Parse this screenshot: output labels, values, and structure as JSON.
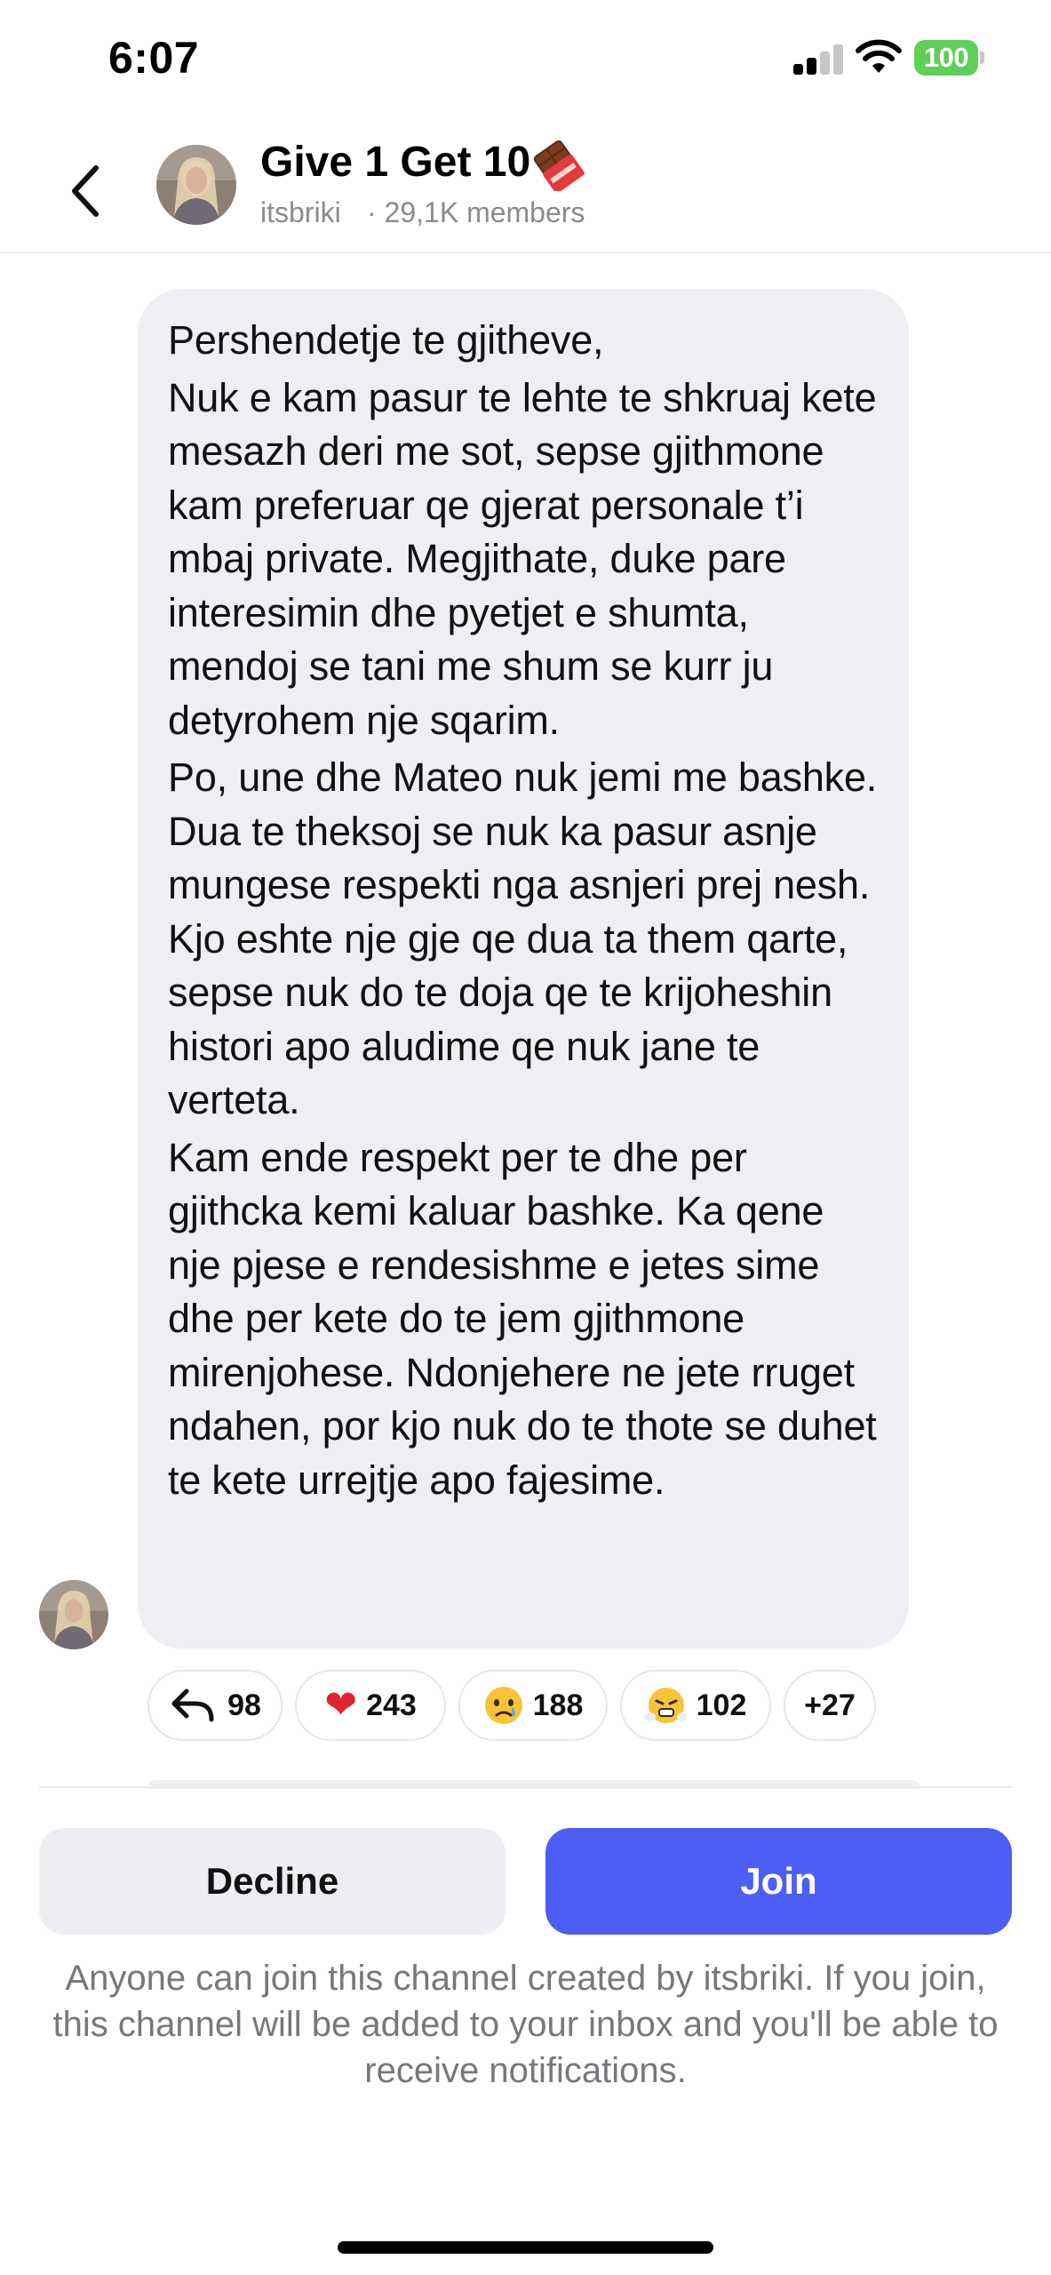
{
  "status_bar": {
    "time": "6:07",
    "battery": "100",
    "icons": [
      "signal-icon",
      "wifi-icon",
      "battery-icon"
    ],
    "battery_color": "#5fcf5a"
  },
  "header": {
    "back_icon": "chevron-left-icon",
    "title": "Give 1 Get 10",
    "title_emoji": "chocolate-bar-icon",
    "owner": "itsbriki",
    "members": "· 29,1K members"
  },
  "message": {
    "paragraphs": [
      "Pershendetje te gjitheve,",
      "Nuk e kam pasur te lehte te shkruaj kete mesazh deri me sot, sepse gjithmone kam preferuar qe gjerat personale t’i mbaj private. Megjithate, duke pare interesimin dhe pyetjet e shumta, mendoj se tani me shum se kurr ju detyrohem nje sqarim.",
      "Po, une dhe Mateo nuk jemi me bashke. Dua te theksoj se nuk ka pasur asnje mungese respekti nga asnjeri prej nesh. Kjo eshte nje gje qe dua ta them qarte, sepse nuk do te doja qe te krijoheshin histori apo aludime qe nuk jane te verteta.",
      "Kam ende respekt per te dhe per gjithcka kemi kaluar bashke. Ka qene nje pjese e rendesishme e jetes sime dhe per kete do te jem gjithmone mirenjohese. Ndonjehere ne jete rruget ndahen, por kjo nuk do te thote se duhet te kete urrejtje apo fajesime."
    ]
  },
  "reactions": [
    {
      "icon": "reply-icon",
      "emoji": "",
      "count": "98"
    },
    {
      "icon": "heart-emoji",
      "emoji": "❤️",
      "count": "243"
    },
    {
      "icon": "crying-face-emoji",
      "emoji": "😢",
      "count": "188"
    },
    {
      "icon": "steam-face-emoji",
      "emoji": "😤",
      "count": "102"
    },
    {
      "icon": "more-reactions",
      "emoji": "",
      "count": "+27"
    }
  ],
  "footer": {
    "decline_label": "Decline",
    "join_label": "Join",
    "notice": "Anyone can join this channel created by itsbriki. If you join, this channel will be added to your inbox and you'll be able to receive notifications.",
    "join_color": "#4d5ef5"
  }
}
